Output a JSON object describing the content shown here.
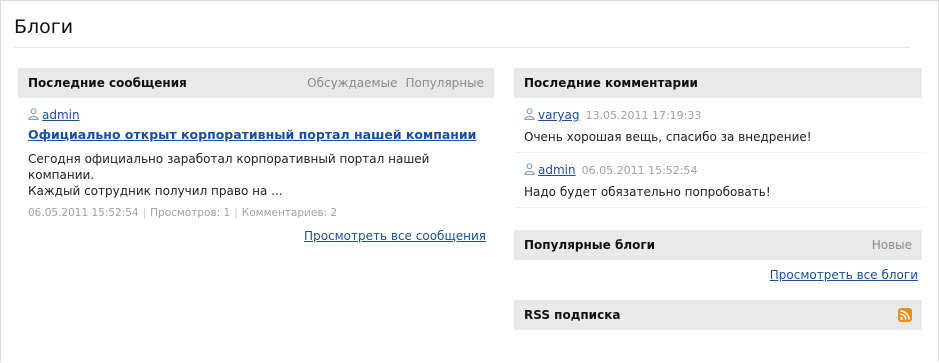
{
  "page": {
    "title": "Блоги"
  },
  "latest_posts": {
    "heading": "Последние сообщения",
    "tabs": [
      "Обсуждаемые",
      "Популярные"
    ],
    "post": {
      "author": "admin",
      "title": "Официально открыт корпоративный портал нашей компании",
      "excerpt_line1": "Сегодня официально заработал корпоративный портал нашей компании.",
      "excerpt_line2": "Каждый сотрудник получил право на ...",
      "date": "06.05.2011 15:52:54",
      "views": "Просмотров: 1",
      "comments": "Комментариев: 2"
    },
    "view_all": "Просмотреть все сообщения"
  },
  "latest_comments": {
    "heading": "Последние комментарии",
    "items": [
      {
        "author": "varyag",
        "date": "13.05.2011 17:19:33",
        "text": "Очень хорошая вещь, спасибо за внедрение!"
      },
      {
        "author": "admin",
        "date": "06.05.2011 15:52:54",
        "text": "Надо будет обязательно попробовать!"
      }
    ]
  },
  "popular_blogs": {
    "heading": "Популярные блоги",
    "tab": "Новые",
    "view_all": "Просмотреть все блоги"
  },
  "rss": {
    "heading": "RSS подписка",
    "icon": "rss-icon",
    "icon_color": "#f28b1a"
  },
  "colors": {
    "link": "#1a4fa0",
    "header_bg": "#e9e9e9",
    "muted": "#a0a0a0"
  }
}
